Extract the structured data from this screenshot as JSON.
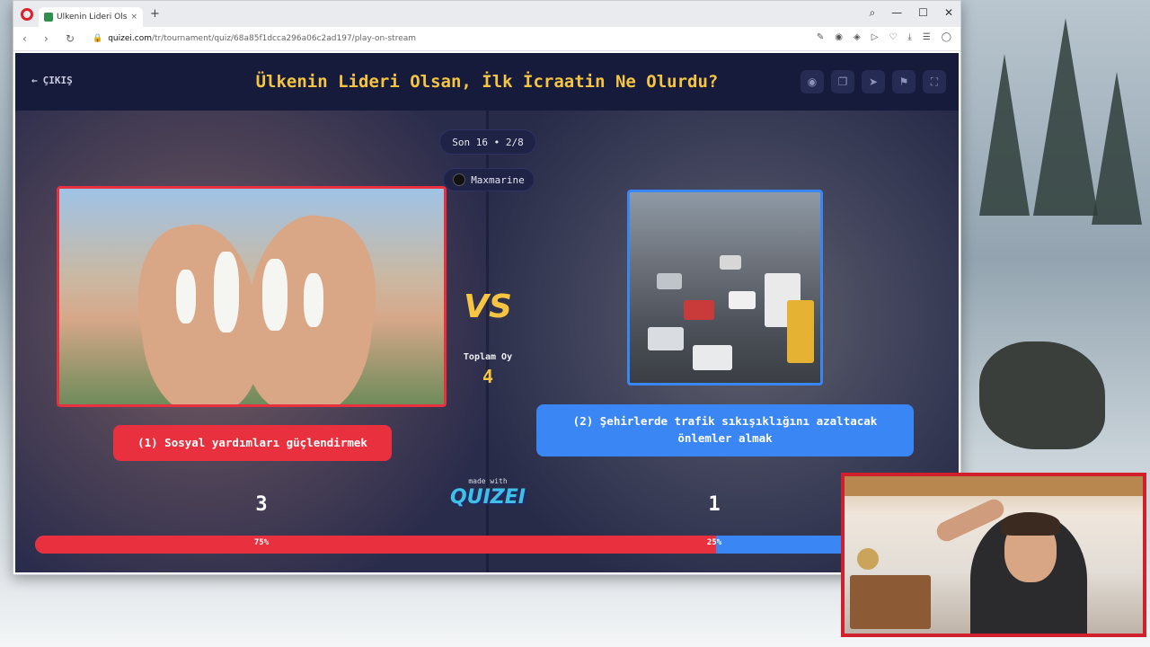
{
  "browser": {
    "tab_title": "Ülkenin Lideri Olsan, İlk İc",
    "tab_close": "×",
    "new_tab": "+",
    "url_domain": "quizei.com",
    "url_path": "/tr/tournament/quiz/68a85f1dcca296a06c2ad197/play-on-stream",
    "controls": {
      "search": "⌕",
      "minimize": "—",
      "maximize": "☐",
      "close": "✕"
    },
    "nav": {
      "back": "‹",
      "forward": "›",
      "reload": "↻"
    }
  },
  "quiz": {
    "exit_label": "ÇIKIŞ",
    "title": "Ülkenin Lideri Olsan, İlk İcraatin Ne Olurdu?",
    "round_label": "Son 16 • 2/8",
    "username": "Maxmarine",
    "total_label": "Toplam Oy",
    "total_votes": "4",
    "vs_text": "VS",
    "made_with": "made with",
    "brand": "QUIZEI",
    "options": [
      {
        "label": "(1) Sosyal yardımları güçlendirmek",
        "votes": "3",
        "percent_text": "75%",
        "percent": 75,
        "color": "#e8303f"
      },
      {
        "label": "(2) Şehirlerde trafik sıkışıklığını azaltacak önlemler almak",
        "votes": "1",
        "percent_text": "25%",
        "percent": 25,
        "color": "#3b86f5"
      }
    ],
    "accent_color": "#f5c542"
  }
}
